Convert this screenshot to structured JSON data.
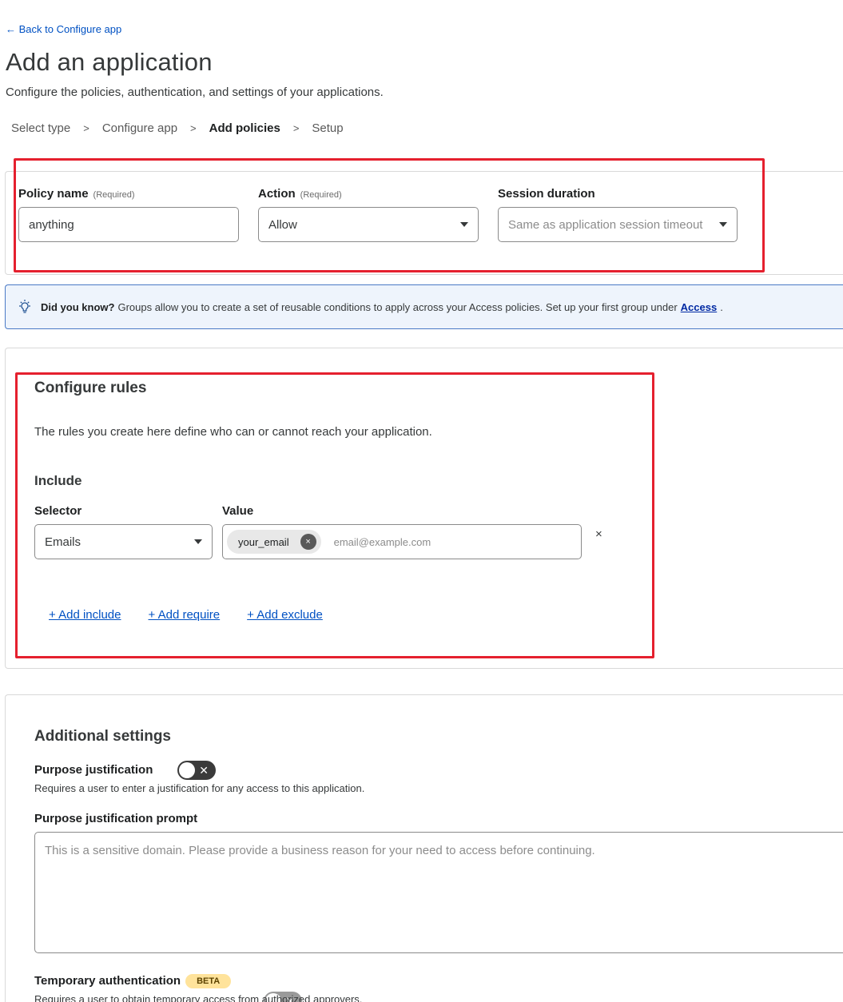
{
  "nav": {
    "back_label": "← Back to Configure app"
  },
  "page": {
    "title": "Add an application",
    "subtitle": "Configure the policies, authentication, and settings of your applications."
  },
  "steps": {
    "step1": "Select type",
    "step2": "Configure app",
    "step3": "Add policies",
    "step4": "Setup",
    "separator": ">"
  },
  "policy": {
    "name_label": "Policy name",
    "name_required": "(Required)",
    "name_value": "anything",
    "action_label": "Action",
    "action_required": "(Required)",
    "action_value": "Allow",
    "session_label": "Session duration",
    "session_placeholder": "Same as application session timeout"
  },
  "tip": {
    "bold": "Did you know?",
    "text": "Groups allow you to create a set of reusable conditions to apply across your Access policies. Set up your first group under",
    "link": "Access",
    "suffix": "."
  },
  "rules": {
    "title": "Configure rules",
    "description": "The rules you create here define who can or cannot reach your application.",
    "include_heading": "Include",
    "selector_label": "Selector",
    "value_label": "Value",
    "selector_value": "Emails",
    "chip_value": "your_email",
    "chip_remove": "×",
    "value_placeholder": "email@example.com",
    "remove_rule": "×",
    "add_include": "+ Add include",
    "add_require": "+ Add require",
    "add_exclude": "+ Add exclude"
  },
  "additional": {
    "title": "Additional settings",
    "purpose_label": "Purpose justification",
    "purpose_toggle_mark": "✕",
    "purpose_desc": "Requires a user to enter a justification for any access to this application.",
    "prompt_label": "Purpose justification prompt",
    "prompt_placeholder": "This is a sensitive domain. Please provide a business reason for your need to access before continuing.",
    "temp_label": "Temporary authentication",
    "temp_badge": "BETA",
    "temp_toggle_mark": "✕",
    "temp_desc": "Requires a user to obtain temporary access from authorized approvers."
  },
  "colors": {
    "link": "#0051c3",
    "highlight_border": "#e5202e",
    "tip_background": "#eef4fc",
    "tip_border": "#4a7ac6",
    "beta_badge": "#ffe39b"
  }
}
